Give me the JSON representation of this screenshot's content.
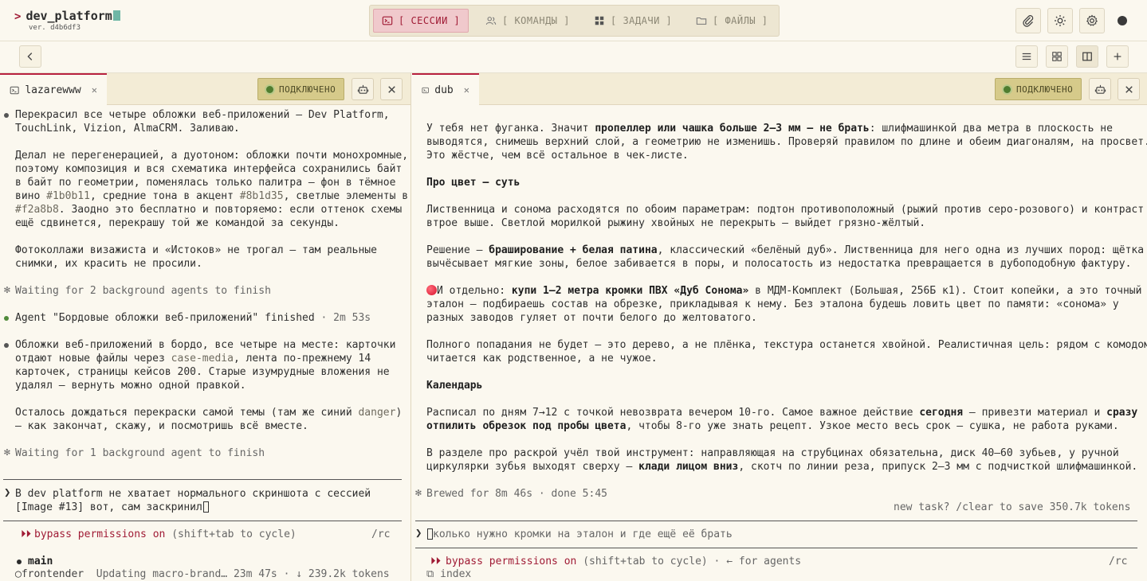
{
  "app": {
    "prompt_symbol": ">",
    "title": "dev_platform",
    "version": "ver. d4b6df3"
  },
  "nav_tabs": [
    {
      "label": "[ СЕССИИ ]",
      "icon": "terminal-icon",
      "active": true
    },
    {
      "label": "[ КОМАНДЫ ]",
      "icon": "users-icon",
      "active": false
    },
    {
      "label": "[ ЗАДАЧИ ]",
      "icon": "grid-icon",
      "active": false
    },
    {
      "label": "[ ФАЙЛЫ ]",
      "icon": "folder-icon",
      "active": false
    }
  ],
  "left_pane": {
    "tab_label": "lazarewww",
    "status": "ПОДКЛЮЧЕНО",
    "lines": {
      "l1": "Перекрасил все четыре обложки веб-приложений — Dev Platform,",
      "l2": "TouchLink, Vizion, AlmaCRM. Заливаю.",
      "l3": "Делал не перегенерацией, а дуотоном: обложки почти монохромные,",
      "l4": "поэтому композиция и вся схематика интерфейса сохранились байт",
      "l5": "в байт по геометрии, поменялась только палитра — фон в тёмное",
      "l6a": "вино ",
      "l6b": "#1b0b11",
      "l6c": ", средние тона в акцент ",
      "l6d": "#8b1d35",
      "l6e": ", светлые элементы в",
      "l7a": "#f2a8b8",
      "l7b": ". Заодно это бесплатно и повторяемо: если оттенок схемы",
      "l8": "ещё сдвинется, перекрашу той же командой за секунды.",
      "l9": "Фотоколлажи визажиста и «Истоков» не трогал — там реальные",
      "l10": "снимки, их красить не просили.",
      "w1": "Waiting for 2 background agents to finish",
      "a1a": "Agent \"Бордовые обложки веб-приложений\" finished",
      "a1b": " · 2m 53s",
      "m1": "Обложки веб-приложений в бордо, все четыре на месте: карточки",
      "m2a": "отдают новые файлы через ",
      "m2b": "case-media",
      "m2c": ", лента по-прежнему 14",
      "m3": "карточек, страницы кейсов 200. Старые изумрудные вложения не",
      "m4": "удалял — вернуть можно одной правкой.",
      "m5a": "Осталось дождаться перекраски самой темы (там же синий ",
      "m5b": "danger",
      "m5c": ")",
      "m6": "— как закончат, скажу, и посмотришь всё вместе.",
      "w2": "Waiting for 1 background agent to finish",
      "in1": "В dev platform не хватает нормального скриншота с сессией",
      "in2": "[Image #13] вот, сам заскринил",
      "bypass": "bypass permissions on",
      "bypass_hint": " (shift+tab to cycle)",
      "rc": "/rc",
      "branch": "main",
      "agent_name": "frontender",
      "agent_status": "Updating macro-brand… 23m 47s · ↓ 239.2k tokens"
    }
  },
  "right_pane": {
    "tab_label": "dub",
    "status": "ПОДКЛЮЧЕНО",
    "lines": {
      "r1a": "У тебя нет фуганка. Значит ",
      "r1b": "пропеллер или чашка больше 2–3 мм — не брать",
      "r1c": ": шлифмашинкой два метра в плоскость не",
      "r2": "выводятся, снимешь верхний слой, а геометрию не изменишь. Проверяй правилом по длине и обеим диагоналям, на просвет.",
      "r3": "Это жёстче, чем всё остальное в чек-листе.",
      "h1": "Про цвет — суть",
      "r4": "Лиственница и сонома расходятся по обоим параметрам: подтон противоположный (рыжий против серо-розового) и контраст",
      "r5": "втрое выше. Светлой морилкой рыжину хвойных не перекрыть — выйдет грязно-жёлтый.",
      "r6a": "Решение — ",
      "r6b": "браширование + белая патина",
      "r6c": ", классический «белёный дуб». Лиственница для него одна из лучших пород: щётка",
      "r7": "вычёсывает мягкие зоны, белое забивается в поры, и полосатость из недостатка превращается в дубоподобную фактуру.",
      "r8a": "И отдельно: ",
      "r8b": "купи 1–2 метра кромки ПВХ «Дуб Сонома»",
      "r8c": " в МДМ-Комплект (Большая, 256Б к1). Стоит копейки, а это точный",
      "r9": "эталон — подбираешь состав на обрезке, прикладывая к нему. Без эталона будешь ловить цвет по памяти: «сонома» у",
      "r10": "разных заводов гуляет от почти белого до желтоватого.",
      "r11": "Полного попадания не будет — это дерево, а не плёнка, текстура останется хвойной. Реалистичная цель: рядом с комодом",
      "r12": "читается как родственное, а не чужое.",
      "h2": "Календарь",
      "r13a": "Расписал по дням 7→12 с точкой невозврата вечером 10-го. Самое важное действие ",
      "r13b": "сегодня",
      "r13c": " — привезти материал и ",
      "r13d": "сразу",
      "r14a": "отпилить обрезок под пробы цвета",
      "r14b": ", чтобы 8-го уже знать рецепт. Узкое место весь срок — сушка, не работа руками.",
      "r15": "В разделе про раскрой учёл твой инструмент: направляющая на струбцинах обязательна, диск 40–60 зубьев, у ручной",
      "r16a": "циркулярки зубья выходят сверху — ",
      "r16b": "клади лицом вниз",
      "r16c": ", скотч по линии реза, припуск 2–3 мм с подчисткой шлифмашинкой.",
      "brewed": "Brewed for 8m 46s · done 5:45",
      "new_task": "new task? /clear to save 350.7k tokens",
      "input": "колько нужно кромки на эталон и где ещё её брать",
      "bypass": "bypass permissions on",
      "bypass_hint": " (shift+tab to cycle) · ← for agents",
      "rc": "/rc",
      "index": "index"
    }
  },
  "colors": {
    "accent": "#a01b35",
    "background": "#fbf8ef",
    "connected": "#d6ca8a"
  }
}
